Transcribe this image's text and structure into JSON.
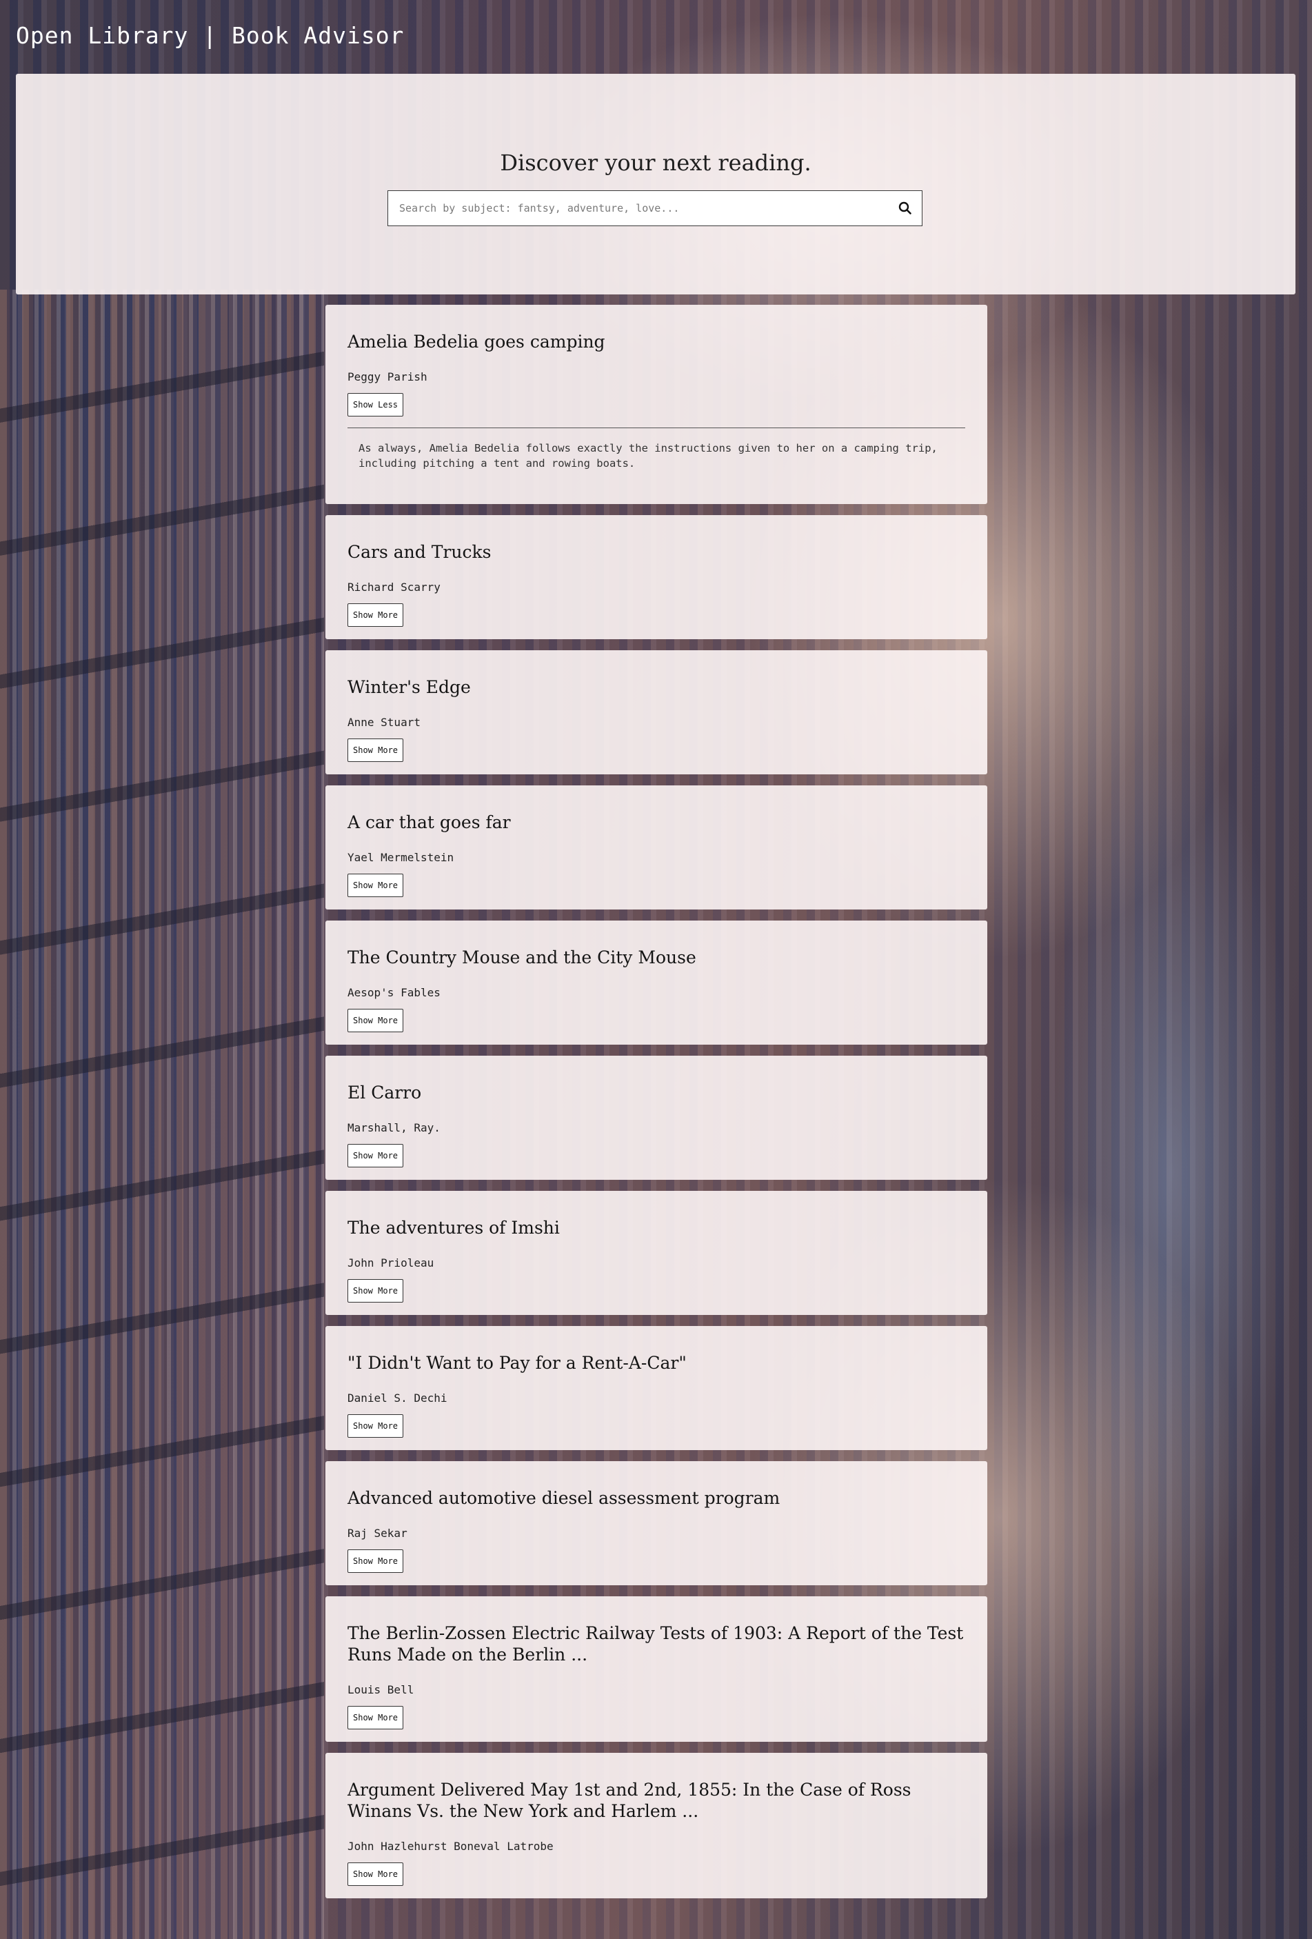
{
  "app": {
    "title": "Open Library | Book Advisor"
  },
  "hero": {
    "heading": "Discover your next reading.",
    "search_placeholder": "Search by subject: fantsy, adventure, love...",
    "search_value": ""
  },
  "books": [
    {
      "title": "Amelia Bedelia goes camping",
      "author": "Peggy Parish",
      "toggle_label": "Show Less",
      "expanded": true,
      "description": "As always, Amelia Bedelia follows exactly the instructions given to her on a camping trip, including pitching a tent and rowing boats."
    },
    {
      "title": "Cars and Trucks",
      "author": "Richard Scarry",
      "toggle_label": "Show More"
    },
    {
      "title": "Winter's Edge",
      "author": "Anne Stuart",
      "toggle_label": "Show More"
    },
    {
      "title": "A car that goes far",
      "author": "Yael Mermelstein",
      "toggle_label": "Show More"
    },
    {
      "title": "The Country Mouse and the City Mouse",
      "author": "Aesop's Fables",
      "toggle_label": "Show More"
    },
    {
      "title": "El Carro",
      "author": "Marshall, Ray.",
      "toggle_label": "Show More"
    },
    {
      "title": "The adventures of Imshi",
      "author": "John Prioleau",
      "toggle_label": "Show More"
    },
    {
      "title": "\"I Didn't Want to Pay for a Rent-A-Car\"",
      "author": "Daniel S. Dechi",
      "toggle_label": "Show More"
    },
    {
      "title": "Advanced automotive diesel assessment program",
      "author": "Raj Sekar",
      "toggle_label": "Show More"
    },
    {
      "title": "The Berlin-Zossen Electric Railway Tests of 1903: A Report of the Test Runs Made on the Berlin ...",
      "author": "Louis Bell",
      "toggle_label": "Show More"
    },
    {
      "title": "Argument Delivered May 1st and 2nd, 1855: In the Case of Ross Winans Vs. the New York and Harlem ...",
      "author": "John Hazlehurst Boneval Latrobe",
      "toggle_label": "Show More"
    }
  ],
  "icons": {
    "search": "search-icon"
  }
}
